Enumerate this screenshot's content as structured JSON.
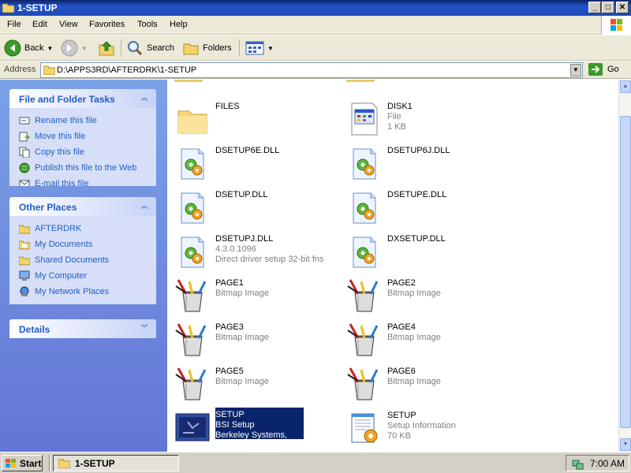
{
  "window": {
    "title": "1-SETUP",
    "min": "_",
    "max": "□",
    "close": "✕"
  },
  "menu": [
    "File",
    "Edit",
    "View",
    "Favorites",
    "Tools",
    "Help"
  ],
  "toolbar": {
    "back": "Back",
    "search": "Search",
    "folders": "Folders"
  },
  "address": {
    "label": "Address",
    "path": "D:\\APPS3RD\\AFTERDRK\\1-SETUP",
    "go": "Go"
  },
  "tasks": {
    "title": "File and Folder Tasks",
    "items": [
      "Rename this file",
      "Move this file",
      "Copy this file",
      "Publish this file to the Web",
      "E-mail this file"
    ]
  },
  "places": {
    "title": "Other Places",
    "items": [
      "AFTERDRK",
      "My Documents",
      "Shared Documents",
      "My Computer",
      "My Network Places"
    ]
  },
  "details": {
    "title": "Details"
  },
  "files": [
    {
      "name": "FILES",
      "lines": [],
      "icon": "folder"
    },
    {
      "name": "DISK1",
      "lines": [
        "File",
        "1 KB"
      ],
      "icon": "file"
    },
    {
      "name": "DSETUP6E.DLL",
      "lines": [],
      "icon": "dll"
    },
    {
      "name": "DSETUP6J.DLL",
      "lines": [],
      "icon": "dll"
    },
    {
      "name": "DSETUP.DLL",
      "lines": [],
      "icon": "dll"
    },
    {
      "name": "DSETUPE.DLL",
      "lines": [],
      "icon": "dll"
    },
    {
      "name": "DSETUPJ.DLL",
      "lines": [
        "4.3.0.1096",
        "Direct driver setup 32-bit fns"
      ],
      "icon": "dll"
    },
    {
      "name": "DXSETUP.DLL",
      "lines": [],
      "icon": "dll"
    },
    {
      "name": "PAGE1",
      "lines": [
        "Bitmap Image"
      ],
      "icon": "bitmap"
    },
    {
      "name": "PAGE2",
      "lines": [
        "Bitmap Image"
      ],
      "icon": "bitmap"
    },
    {
      "name": "PAGE3",
      "lines": [
        "Bitmap Image"
      ],
      "icon": "bitmap"
    },
    {
      "name": "PAGE4",
      "lines": [
        "Bitmap Image"
      ],
      "icon": "bitmap"
    },
    {
      "name": "PAGE5",
      "lines": [
        "Bitmap Image"
      ],
      "icon": "bitmap"
    },
    {
      "name": "PAGE6",
      "lines": [
        "Bitmap Image"
      ],
      "icon": "bitmap"
    },
    {
      "name": "SETUP",
      "lines": [
        "BSI Setup",
        "Berkeley Systems, Inc."
      ],
      "icon": "setup-exe",
      "selected": true
    },
    {
      "name": "SETUP",
      "lines": [
        "Setup Information",
        "70 KB"
      ],
      "icon": "setup-info"
    }
  ],
  "taskbar": {
    "start": "Start",
    "task": "1-SETUP",
    "time": "7:00 AM"
  },
  "colors": {
    "selection": "#0a246a",
    "link": "#215dc6",
    "titlebar": "#2453c8"
  }
}
